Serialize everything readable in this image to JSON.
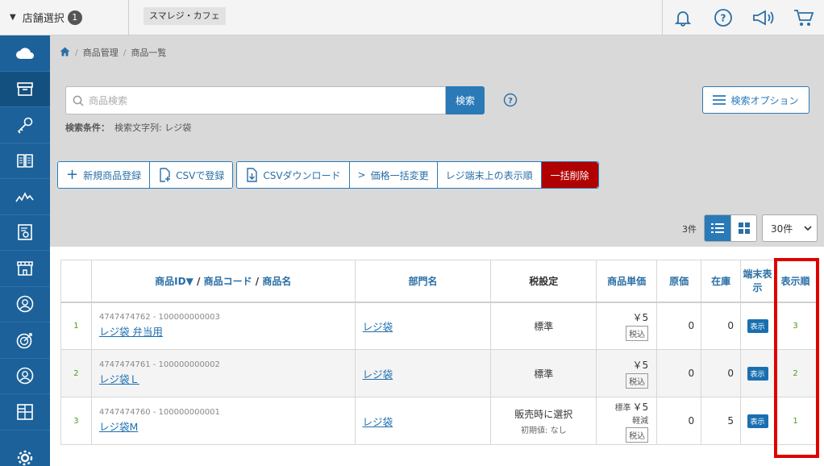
{
  "topbar": {
    "store_select_label": "店舗選択",
    "store_count": "1",
    "store_name": "スマレジ・カフェ",
    "icons": [
      "bell-icon",
      "help-icon",
      "megaphone-icon",
      "cart-icon"
    ]
  },
  "sidebar": {
    "items": [
      "cloud-icon",
      "box-icon",
      "key-icon",
      "book-icon",
      "chart-icon",
      "report-icon",
      "store-icon",
      "customer-icon",
      "target-icon",
      "user-icon",
      "grid-icon",
      "gear-icon"
    ],
    "active_index": 1
  },
  "breadcrumb": {
    "home_icon": "home-icon",
    "items": [
      "商品管理",
      "商品一覧"
    ]
  },
  "search": {
    "placeholder": "商品検索",
    "button_label": "検索",
    "option_label": "検索オプション",
    "condition_label": "検索条件：",
    "condition_value": "検索文字列: レジ袋"
  },
  "toolbar": {
    "new_product": "新規商品登録",
    "csv_register": "CSVで登録",
    "csv_download": "CSVダウンロード",
    "price_bulk": "価格一括変更",
    "display_order": "レジ端末上の表示順",
    "bulk_delete": "一括削除"
  },
  "list_controls": {
    "count": "3件",
    "per_page": "30件"
  },
  "table": {
    "headers": {
      "id_part": "商品ID▼",
      "slash": "/",
      "code_part": "商品コード",
      "name_part": "商品名",
      "department": "部門名",
      "tax": "税設定",
      "unit_price": "商品単価",
      "cost": "原価",
      "stock": "在庫",
      "terminal": "端末表示",
      "order": "表示順"
    },
    "rows": [
      {
        "idx": "1",
        "code": "4747474762 - 100000000003",
        "name": "レジ袋 弁当用",
        "dept": "レジ袋",
        "tax": "標準",
        "tax_sub": "",
        "price_prefix": "",
        "price": "￥5",
        "reduced": "",
        "price_tag": "税込",
        "cost": "0",
        "stock": "0",
        "terminal": "表示",
        "order": "3"
      },
      {
        "idx": "2",
        "code": "4747474761 - 100000000002",
        "name": "レジ袋Ｌ",
        "dept": "レジ袋",
        "tax": "標準",
        "tax_sub": "",
        "price_prefix": "",
        "price": "￥5",
        "reduced": "",
        "price_tag": "税込",
        "cost": "0",
        "stock": "0",
        "terminal": "表示",
        "order": "2"
      },
      {
        "idx": "3",
        "code": "4747474760 - 100000000001",
        "name": "レジ袋M",
        "dept": "レジ袋",
        "tax": "販売時に選択",
        "tax_sub": "初期値: なし",
        "price_prefix": "標準",
        "price": "￥5",
        "reduced": "軽減",
        "price_tag": "税込",
        "cost": "0",
        "stock": "5",
        "terminal": "表示",
        "order": "1"
      }
    ]
  },
  "colors": {
    "accent": "#2a7ab8",
    "sidebar": "#1c6199",
    "danger": "#b00000",
    "highlight": "#e00000"
  }
}
